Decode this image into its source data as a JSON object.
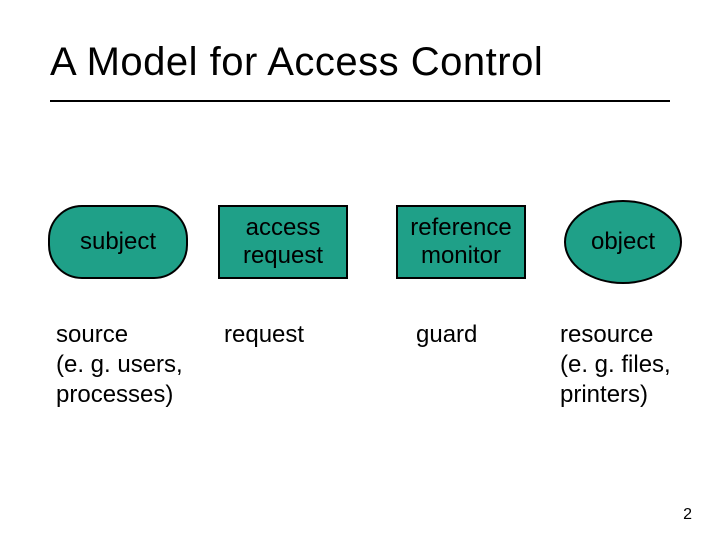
{
  "title": "A Model for Access Control",
  "page_number": "2",
  "colors": {
    "shape_fill": "#1fa088",
    "shape_stroke": "#000000"
  },
  "shapes": {
    "subject": {
      "label": "subject",
      "kind": "rounded-rect"
    },
    "access_request": {
      "label": "access\nrequest",
      "kind": "rect"
    },
    "reference_monitor": {
      "label": "reference\nmonitor",
      "kind": "rect"
    },
    "object": {
      "label": "object",
      "kind": "ellipse"
    }
  },
  "annotations": {
    "subject": "source\n(e. g. users,\nprocesses)",
    "access_request": "request",
    "reference_monitor": "guard",
    "object": "resource\n(e. g. files,\nprinters)"
  }
}
